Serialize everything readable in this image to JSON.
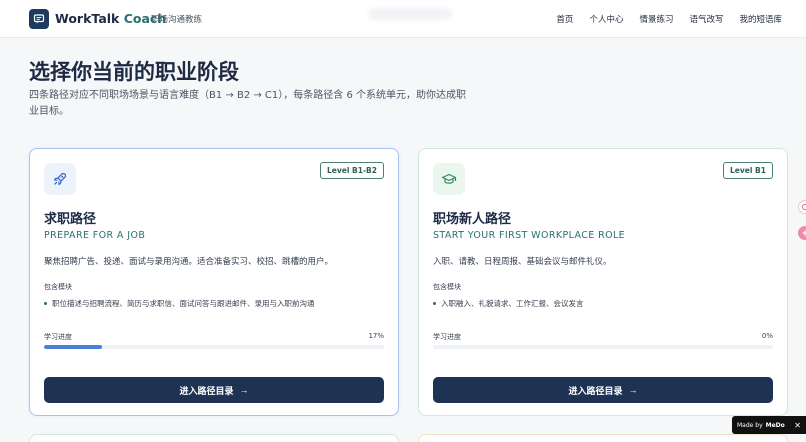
{
  "header": {
    "brand_main": "WorkTalk",
    "brand_accent": "Coach",
    "subtitle": "职场沟通教练",
    "nav": [
      "首页",
      "个人中心",
      "情景练习",
      "语气改写",
      "我的短语库"
    ]
  },
  "hero": {
    "title": "选择你当前的职业阶段",
    "description": "四条路径对应不同职场场景与语言难度（B1 → B2 → C1），每条路径含 6 个系统单元，助你达成职业目标。"
  },
  "cards": [
    {
      "icon": "rocket-icon",
      "badge": "Level B1-B2",
      "title": "求职路径",
      "subtitle_en": "PREPARE FOR A JOB",
      "description": "聚焦招聘广告、投递、面试与录用沟通。适合准备实习、校招、跳槽的用户。",
      "modules_label": "包含模块",
      "modules": "职位描述与招聘流程、简历与求职信、面试问答与跟进邮件、录用与入职前沟通",
      "progress_label": "学习进度",
      "progress_text": "17%",
      "progress": 0.17,
      "button_label": "进入路径目录",
      "button_arrow": "→",
      "accent": "#4a7fd9"
    },
    {
      "icon": "graduation-cap-icon",
      "badge": "Level B1",
      "title": "职场新人路径",
      "subtitle_en": "START YOUR FIRST WORKPLACE ROLE",
      "description": "入职、请教、日程周报、基础会议与邮件礼仪。",
      "modules_label": "包含模块",
      "modules": "入职融入、礼貌请求、工作汇报、会议发言",
      "progress_label": "学习进度",
      "progress_text": "0%",
      "progress": 0,
      "button_label": "进入路径目录",
      "button_arrow": "→",
      "accent": "#4a7fd9"
    }
  ],
  "madeby": {
    "prefix": "Made by",
    "name": "MeDo",
    "close": "✕"
  }
}
